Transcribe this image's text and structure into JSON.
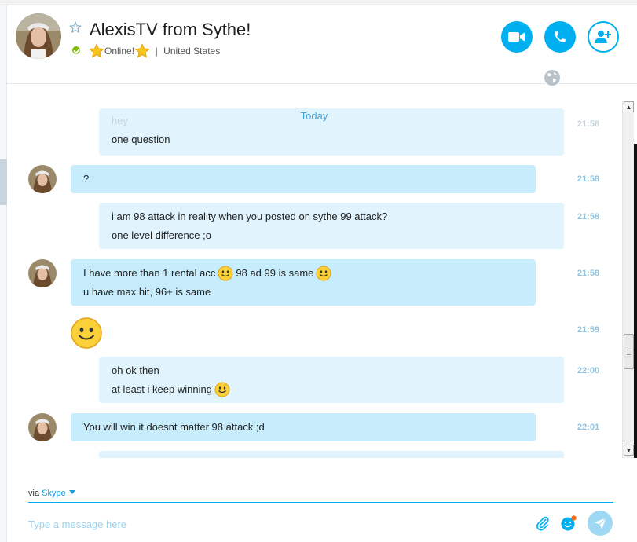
{
  "header": {
    "contact_name": "AlexisTV from Sythe!",
    "mood_text": "Online!",
    "separator": "|",
    "location": "United States"
  },
  "conversation": {
    "date_divider": "Today",
    "messages": [
      {
        "sender": "me",
        "lines": [
          "hey",
          "one question"
        ],
        "time": "21:58"
      },
      {
        "sender": "contact",
        "lines": [
          "?"
        ],
        "time": "21:58"
      },
      {
        "sender": "me",
        "lines": [
          "i am 98 attack in reality when you posted on sythe 99 attack?",
          "one level difference ;o"
        ],
        "time": "21:58"
      },
      {
        "sender": "contact",
        "lines": [
          "I have more than 1 rental acc",
          "98 ad 99 is same",
          "u have max hit, 96+ is same"
        ],
        "time": "21:58"
      },
      {
        "sender": "contact",
        "lines": [],
        "time": "21:59"
      },
      {
        "sender": "me",
        "lines": [
          "oh ok then",
          "at least i keep winning"
        ],
        "time": "22:00"
      },
      {
        "sender": "contact",
        "lines": [
          "You will win it doesnt matter 98 attack ;d"
        ],
        "time": "22:01"
      }
    ]
  },
  "composer": {
    "via_label": "via",
    "via_service": "Skype",
    "placeholder": "Type a message here"
  },
  "colors": {
    "accent": "#00aff0",
    "incoming_bubble": "#c7ecfc",
    "outgoing_bubble": "#e1f4fd",
    "timestamp": "#8fc2de",
    "online": "#7fba00"
  },
  "icons": {
    "favorite": "star-outline-icon",
    "presence": "online-check-icon",
    "video": "video-call-icon",
    "call": "phone-icon",
    "add_people": "add-person-icon",
    "globe": "globe-icon",
    "attach": "paperclip-icon",
    "emoticons": "emoticon-icon",
    "send": "send-icon"
  }
}
